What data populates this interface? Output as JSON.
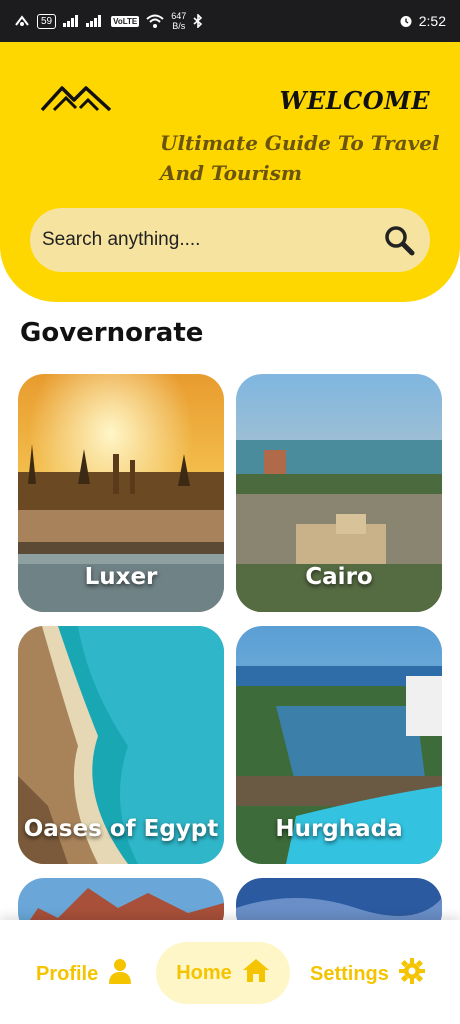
{
  "status_bar": {
    "battery": "59",
    "volte": "VoLTE",
    "net_speed_value": "647",
    "net_speed_unit": "B/s",
    "time": "2:52"
  },
  "header": {
    "welcome": "WELCOME",
    "subtitle": "Ultimate Guide To Travel And Tourism",
    "logo_icon": "mountains-icon",
    "brand_color": "#FFD700"
  },
  "search": {
    "placeholder": "Search anything....",
    "icon": "search-icon"
  },
  "section": {
    "title": "Governorate"
  },
  "cards": [
    {
      "label": "Luxer"
    },
    {
      "label": "Cairo"
    },
    {
      "label": "Oases of Egypt"
    },
    {
      "label": "Hurghada"
    }
  ],
  "bottom_nav": {
    "profile": "Profile",
    "home": "Home",
    "settings": "Settings",
    "active": "Home",
    "accent": "#F5C400"
  }
}
